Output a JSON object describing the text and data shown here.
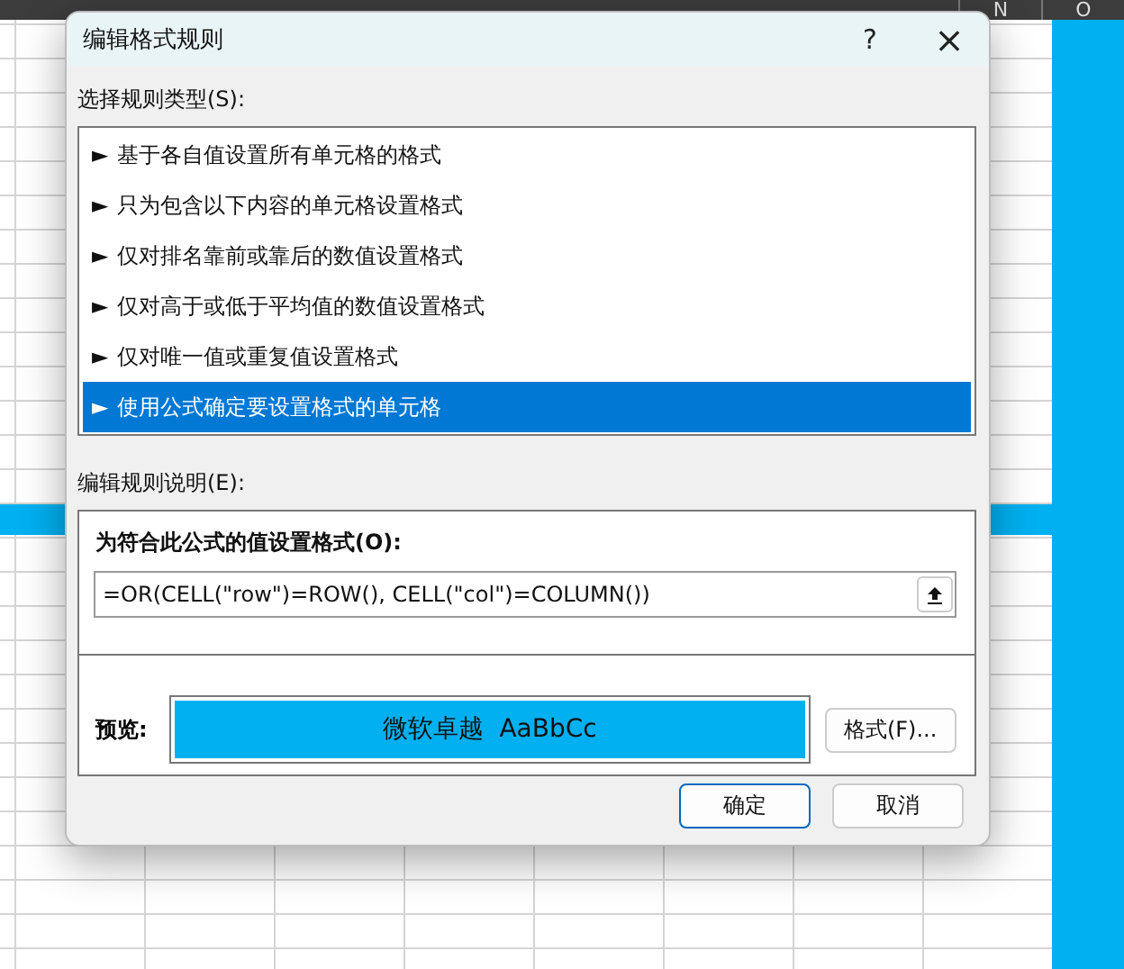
{
  "sheet": {
    "column_headers": [
      "N",
      "O"
    ]
  },
  "dialog": {
    "title": "编辑格式规则",
    "help": "?",
    "close": "×",
    "rule_type_label": "选择规则类型(S):",
    "rule_types": [
      {
        "arrow": "►",
        "label": "基于各自值设置所有单元格的格式",
        "selected": false
      },
      {
        "arrow": "►",
        "label": "只为包含以下内容的单元格设置格式",
        "selected": false
      },
      {
        "arrow": "►",
        "label": "仅对排名靠前或靠后的数值设置格式",
        "selected": false
      },
      {
        "arrow": "►",
        "label": "仅对高于或低于平均值的数值设置格式",
        "selected": false
      },
      {
        "arrow": "►",
        "label": "仅对唯一值或重复值设置格式",
        "selected": false
      },
      {
        "arrow": "►",
        "label": "使用公式确定要设置格式的单元格",
        "selected": true
      }
    ],
    "description_label": "编辑规则说明(E):",
    "formula_label": "为符合此公式的值设置格式(O):",
    "formula": "=OR(CELL(\"row\")=ROW(), CELL(\"col\")=COLUMN())",
    "preview_label": "预览:",
    "preview_text": "微软卓越  AaBbCc",
    "format_button": "格式(F)...",
    "ok": "确定",
    "cancel": "取消"
  }
}
